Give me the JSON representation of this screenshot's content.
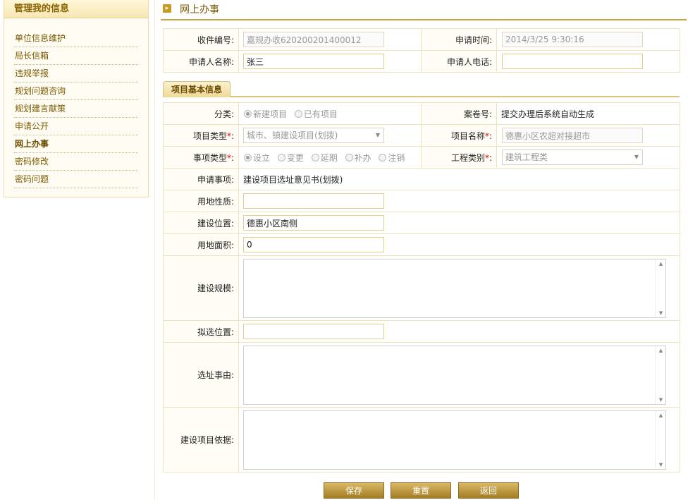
{
  "sidebar": {
    "title": "管理我的信息",
    "items": [
      "单位信息维护",
      "局长信箱",
      "违规举报",
      "规划问题咨询",
      "规划建言献策",
      "申请公开",
      "网上办事",
      "密码修改",
      "密码问题"
    ],
    "active_index": 6
  },
  "header": {
    "title": "网上办事"
  },
  "top_form": {
    "receipt_no_label": "收件编号:",
    "receipt_no_value": "嘉规办收620200201400012",
    "apply_time_label": "申请时间:",
    "apply_time_value": "2014/3/25 9:30:16",
    "applicant_name_label": "申请人名称:",
    "applicant_name_value": "张三",
    "applicant_phone_label": "申请人电话:",
    "applicant_phone_value": ""
  },
  "section_tab": "项目基本信息",
  "project": {
    "category_label": "分类:",
    "category_options": [
      "新建项目",
      "已有项目"
    ],
    "category_selected": "新建项目",
    "case_no_label": "案卷号:",
    "case_no_value": "提交办理后系统自动生成",
    "project_type_label": "项目类型",
    "project_type_value": "城市、镇建设项目(划拨)",
    "project_name_label": "项目名称",
    "project_name_value": "德惠小区农超对接超市",
    "item_type_label": "事项类型",
    "item_type_options": [
      "设立",
      "变更",
      "延期",
      "补办",
      "注销"
    ],
    "item_type_selected": "设立",
    "engineering_label": "工程类别",
    "engineering_value": "建筑工程类",
    "apply_item_label": "申请事项:",
    "apply_item_value": "建设项目选址意见书(划拨)",
    "land_nature_label": "用地性质:",
    "land_nature_value": "",
    "location_label": "建设位置:",
    "location_value": "德惠小区南侧",
    "area_label": "用地面积:",
    "area_value": "0",
    "scale_label": "建设规模:",
    "proposed_location_label": "拟选位置:",
    "proposed_location_value": "",
    "reason_label": "选址事由:",
    "basis_label": "建设项目依据:"
  },
  "required_mark": "*",
  "buttons": {
    "save": "保存",
    "reset": "重置",
    "back": "返回"
  }
}
